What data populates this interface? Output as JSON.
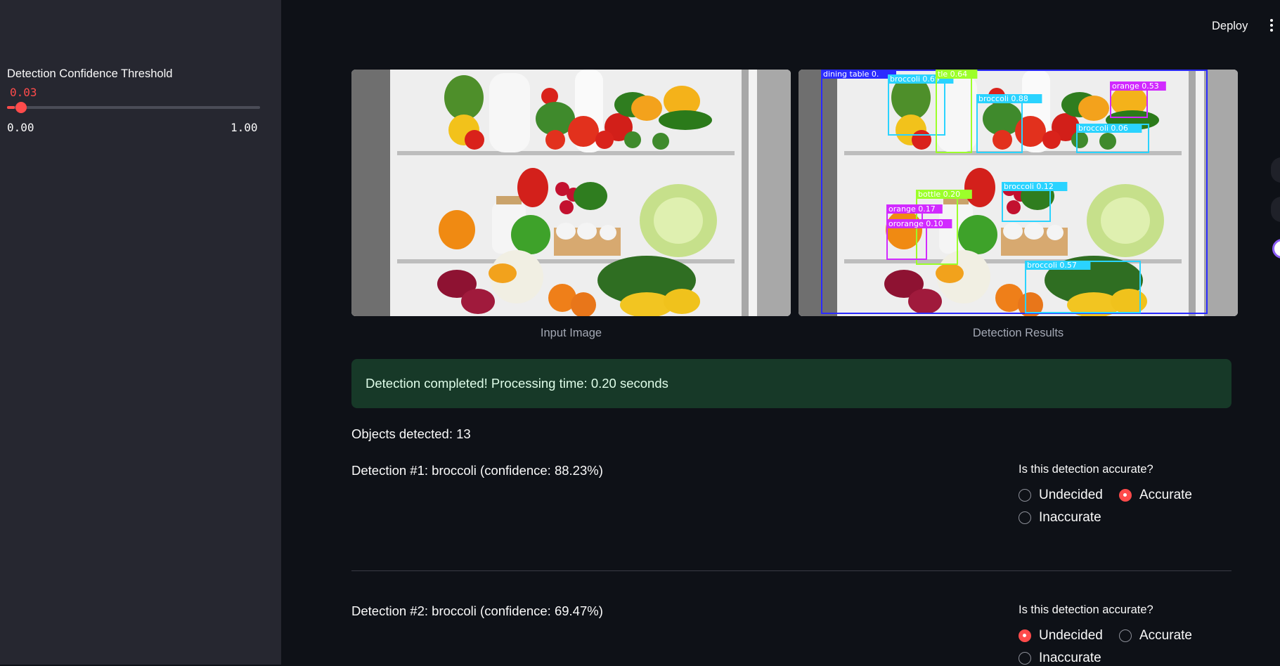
{
  "sidebar": {
    "slider": {
      "label": "Detection Confidence Threshold",
      "value": "0.03",
      "value_fraction": 0.03,
      "min": "0.00",
      "max": "1.00"
    }
  },
  "topbar": {
    "deploy_label": "Deploy",
    "menu_icon": "kebab-menu-icon"
  },
  "images": {
    "input_caption": "Input Image",
    "result_caption": "Detection Results",
    "boxes": [
      {
        "label": "dining table 0.",
        "color": "#2b2bff"
      },
      {
        "label": "broccoli 0.69",
        "color": "#2ad3ff"
      },
      {
        "label": "tle 0.64",
        "color": "#9cff2a"
      },
      {
        "label": "broccoli 0.88",
        "color": "#2ad3ff"
      },
      {
        "label": "orange 0.53",
        "color": "#d12aff"
      },
      {
        "label": "broccoli 0.06",
        "color": "#2ad3ff"
      },
      {
        "label": "bottle 0.20",
        "color": "#9cff2a"
      },
      {
        "label": "broccoli 0.12",
        "color": "#2ad3ff"
      },
      {
        "label": "orange 0.17",
        "color": "#d12aff"
      },
      {
        "label": "ororange 0.10",
        "color": "#d12aff"
      },
      {
        "label": "broccoli 0.57",
        "color": "#2ad3ff"
      }
    ]
  },
  "status": {
    "success_message": "Detection completed! Processing time: 0.20 seconds",
    "objects_detected": "Objects detected: 13"
  },
  "detections": [
    {
      "title": "Detection #1: broccoli (confidence: 88.23%)",
      "question": "Is this detection accurate?",
      "options": [
        "Undecided",
        "Accurate",
        "Inaccurate"
      ],
      "selected": "Accurate"
    },
    {
      "title": "Detection #2: broccoli (confidence: 69.47%)",
      "question": "Is this detection accurate?",
      "options": [
        "Undecided",
        "Accurate",
        "Inaccurate"
      ],
      "selected": "Undecided"
    }
  ],
  "colors": {
    "accent": "#ff4b4b",
    "success_bg": "#173928",
    "sidebar_bg": "#262730",
    "app_bg": "#0e1117"
  }
}
